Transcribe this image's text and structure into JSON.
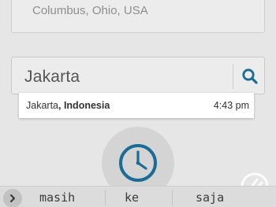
{
  "saved_location": {
    "text": "Columbus, Ohio, USA"
  },
  "search": {
    "query": "Jakarta",
    "icon": "search-icon",
    "icon_color": "#1a6c96"
  },
  "suggestion": {
    "city": "Jakarta",
    "separator": ", ",
    "country": "Indonesia",
    "time": "4:43 pm"
  },
  "clock_button": {
    "icon": "clock-icon",
    "icon_color": "#1a6c96"
  },
  "keyboard": {
    "expand_icon": "chevron-right-icon",
    "suggestions": [
      "masih",
      "ke",
      "saja"
    ]
  },
  "watermark": {
    "icon": "watermark-logo"
  }
}
